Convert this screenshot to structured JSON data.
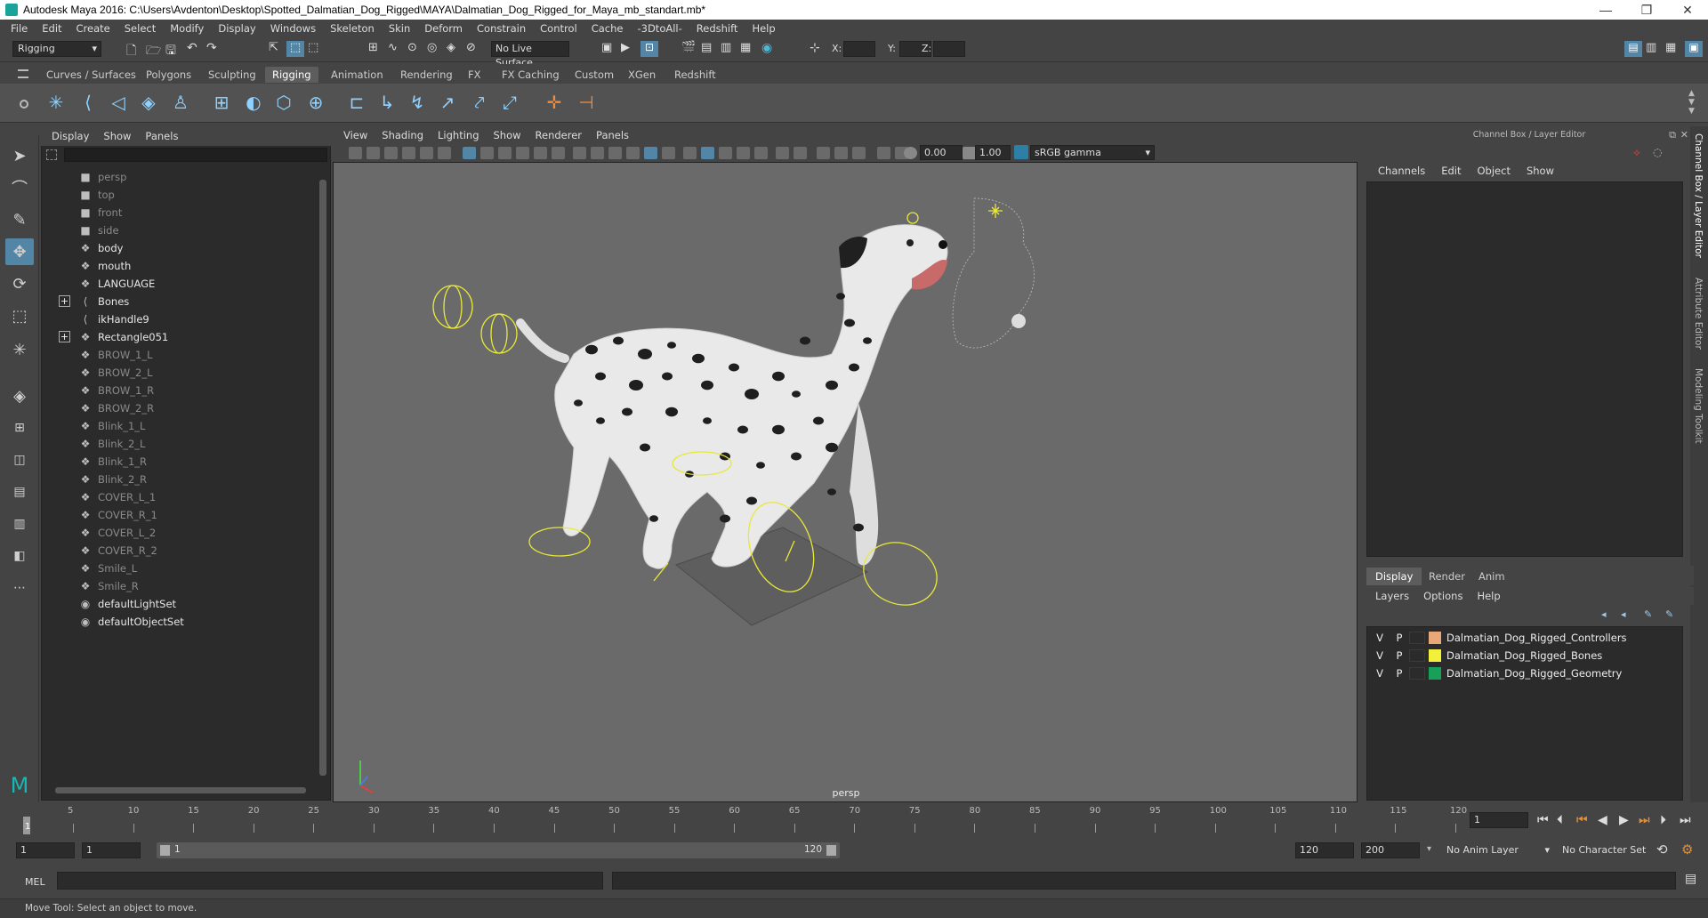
{
  "window": {
    "title": "Autodesk Maya 2016: C:\\Users\\Avdenton\\Desktop\\Spotted_Dalmatian_Dog_Rigged\\MAYA\\Dalmatian_Dog_Rigged_for_Maya_mb_standart.mb*",
    "minimize": "—",
    "maximize": "❐",
    "close": "✕"
  },
  "menubar": [
    "File",
    "Edit",
    "Create",
    "Select",
    "Modify",
    "Display",
    "Windows",
    "Skeleton",
    "Skin",
    "Deform",
    "Constrain",
    "Control",
    "Cache",
    "-3DtoAll-",
    "Redshift",
    "Help"
  ],
  "statusline": {
    "mode": "Rigging",
    "live_surface": "No Live Surface",
    "x_label": "X:",
    "y_label": "Y:",
    "z_label": "Z:"
  },
  "shelf": {
    "tabs": [
      "Curves / Surfaces",
      "Polygons",
      "Sculpting",
      "Rigging",
      "Animation",
      "Rendering",
      "FX",
      "FX Caching",
      "Custom",
      "XGen",
      "Redshift"
    ],
    "active_tab": "Rigging"
  },
  "outliner": {
    "menu": [
      "Display",
      "Show",
      "Panels"
    ],
    "items": [
      {
        "label": "persp",
        "icon": "camera-icon",
        "dim": true
      },
      {
        "label": "top",
        "icon": "camera-icon",
        "dim": true
      },
      {
        "label": "front",
        "icon": "camera-icon",
        "dim": true
      },
      {
        "label": "side",
        "icon": "camera-icon",
        "dim": true
      },
      {
        "label": "body",
        "icon": "mesh-icon",
        "dim": false
      },
      {
        "label": "mouth",
        "icon": "mesh-icon",
        "dim": false
      },
      {
        "label": "LANGUAGE",
        "icon": "mesh-icon",
        "dim": false
      },
      {
        "label": "Bones",
        "icon": "joint-icon",
        "dim": false,
        "expand": true
      },
      {
        "label": "ikHandle9",
        "icon": "ik-handle-icon",
        "dim": false
      },
      {
        "label": "Rectangle051",
        "icon": "mesh-icon",
        "dim": false,
        "expand": true
      },
      {
        "label": "BROW_1_L",
        "icon": "mesh-icon",
        "dim": true
      },
      {
        "label": "BROW_2_L",
        "icon": "mesh-icon",
        "dim": true
      },
      {
        "label": "BROW_1_R",
        "icon": "mesh-icon",
        "dim": true
      },
      {
        "label": "BROW_2_R",
        "icon": "mesh-icon",
        "dim": true
      },
      {
        "label": "Blink_1_L",
        "icon": "mesh-icon",
        "dim": true
      },
      {
        "label": "Blink_2_L",
        "icon": "mesh-icon",
        "dim": true
      },
      {
        "label": "Blink_1_R",
        "icon": "mesh-icon",
        "dim": true
      },
      {
        "label": "Blink_2_R",
        "icon": "mesh-icon",
        "dim": true
      },
      {
        "label": "COVER_L_1",
        "icon": "mesh-icon",
        "dim": true
      },
      {
        "label": "COVER_R_1",
        "icon": "mesh-icon",
        "dim": true
      },
      {
        "label": "COVER_L_2",
        "icon": "mesh-icon",
        "dim": true
      },
      {
        "label": "COVER_R_2",
        "icon": "mesh-icon",
        "dim": true
      },
      {
        "label": "Smile_L",
        "icon": "mesh-icon",
        "dim": true
      },
      {
        "label": "Smile_R",
        "icon": "mesh-icon",
        "dim": true
      },
      {
        "label": "defaultLightSet",
        "icon": "set-icon",
        "dim": false
      },
      {
        "label": "defaultObjectSet",
        "icon": "set-icon",
        "dim": false
      }
    ]
  },
  "viewport": {
    "menu": [
      "View",
      "Shading",
      "Lighting",
      "Show",
      "Renderer",
      "Panels"
    ],
    "exposure": "0.00",
    "gamma": "1.00",
    "color_space": "sRGB gamma",
    "camera_label": "persp"
  },
  "channelbox": {
    "title": "Channel Box / Layer Editor",
    "menu": [
      "Channels",
      "Edit",
      "Object",
      "Show"
    ],
    "side_tabs": [
      "Channel Box / Layer Editor",
      "Attribute Editor",
      "Modeling Toolkit"
    ]
  },
  "layers": {
    "tabs": [
      "Display",
      "Render",
      "Anim"
    ],
    "active_tab": "Display",
    "menu": [
      "Layers",
      "Options",
      "Help"
    ],
    "rows": [
      {
        "v": "V",
        "p": "P",
        "name": "Dalmatian_Dog_Rigged_Controllers",
        "color": "#e8a878"
      },
      {
        "v": "V",
        "p": "P",
        "name": "Dalmatian_Dog_Rigged_Bones",
        "color": "#f2f03a"
      },
      {
        "v": "V",
        "p": "P",
        "name": "Dalmatian_Dog_Rigged_Geometry",
        "color": "#16a05a"
      }
    ]
  },
  "timeline": {
    "ticks": [
      "1",
      "5",
      "10",
      "15",
      "20",
      "25",
      "30",
      "35",
      "40",
      "45",
      "50",
      "55",
      "60",
      "65",
      "70",
      "75",
      "80",
      "85",
      "90",
      "95",
      "100",
      "105",
      "110",
      "115",
      "120"
    ],
    "current_frame": "1"
  },
  "range": {
    "start": "1",
    "anim_start": "1",
    "range_start_label": "1",
    "range_end_label": "120",
    "anim_end": "120",
    "end": "200",
    "anim_layer": "No Anim Layer",
    "character_set": "No Character Set"
  },
  "command": {
    "label": "MEL"
  },
  "help": {
    "text": "Move Tool: Select an object to move."
  }
}
